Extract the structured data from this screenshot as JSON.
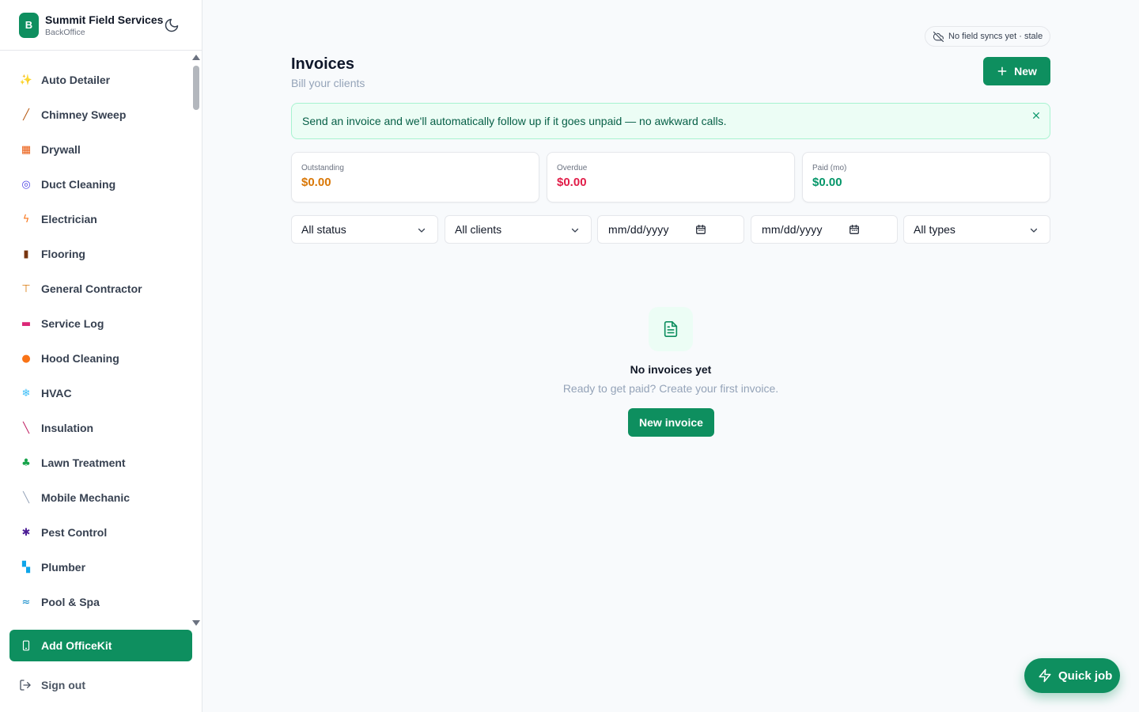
{
  "brand": {
    "logo_letter": "B",
    "title": "Summit Field Services",
    "subtitle": "BackOffice"
  },
  "sidebar": {
    "items": [
      {
        "icon": "sparkles-icon",
        "glyph": "✨",
        "color": "#f59e0b",
        "label": "Auto Detailer"
      },
      {
        "icon": "broom-icon",
        "glyph": "╱",
        "color": "#b45309",
        "label": "Chimney Sweep"
      },
      {
        "icon": "bricks-icon",
        "glyph": "▦",
        "color": "#ea580c",
        "label": "Drywall"
      },
      {
        "icon": "spiral-icon",
        "glyph": "◎",
        "color": "#4f46e5",
        "label": "Duct Cleaning"
      },
      {
        "icon": "lightning-icon",
        "glyph": "ϟ",
        "color": "#f97316",
        "label": "Electrician"
      },
      {
        "icon": "wood-icon",
        "glyph": "▮",
        "color": "#78350f",
        "label": "Flooring"
      },
      {
        "icon": "crane-icon",
        "glyph": "⊤",
        "color": "#d97706",
        "label": "General Contractor"
      },
      {
        "icon": "toolbox-icon",
        "glyph": "▬",
        "color": "#db2777",
        "label": "Service Log"
      },
      {
        "icon": "fire-icon",
        "glyph": "●",
        "color": "#f97316",
        "label": "Hood Cleaning"
      },
      {
        "icon": "snowflake-icon",
        "glyph": "❄",
        "color": "#38bdf8",
        "label": "HVAC"
      },
      {
        "icon": "brush-icon",
        "glyph": "╲",
        "color": "#be185d",
        "label": "Insulation"
      },
      {
        "icon": "seedling-icon",
        "glyph": "♣",
        "color": "#16a34a",
        "label": "Lawn Treatment"
      },
      {
        "icon": "wrench-icon",
        "glyph": "╲",
        "color": "#94a3b8",
        "label": "Mobile Mechanic"
      },
      {
        "icon": "ant-icon",
        "glyph": "✱",
        "color": "#4c1d95",
        "label": "Pest Control"
      },
      {
        "icon": "pipe-icon",
        "glyph": "▚",
        "color": "#0ea5e9",
        "label": "Plumber"
      },
      {
        "icon": "swimmer-icon",
        "glyph": "≈",
        "color": "#0284c7",
        "label": "Pool & Spa"
      }
    ]
  },
  "add_kit_label": "Add OfficeKit",
  "sign_out_label": "Sign out",
  "sync_status": "No field syncs yet · stale",
  "header": {
    "title": "Invoices",
    "subtitle": "Bill your clients",
    "new_label": "New"
  },
  "banner": {
    "text": "Send an invoice and we'll automatically follow up if it goes unpaid — no awkward calls."
  },
  "stats": [
    {
      "label": "Outstanding",
      "value": "$0.00",
      "color": "#d97706"
    },
    {
      "label": "Overdue",
      "value": "$0.00",
      "color": "#e11d48"
    },
    {
      "label": "Paid (mo)",
      "value": "$0.00",
      "color": "#059669"
    }
  ],
  "filters": {
    "status": "All status",
    "clients": "All clients",
    "date_from": "mm/dd/yyyy",
    "date_to": "mm/dd/yyyy",
    "types": "All types"
  },
  "empty": {
    "title": "No invoices yet",
    "subtitle": "Ready to get paid? Create your first invoice.",
    "button": "New invoice"
  },
  "quick_job_label": "Quick job",
  "colors": {
    "primary": "#0e8f5f",
    "banner_bg": "#ecfdf5",
    "muted": "#94a3b8"
  }
}
